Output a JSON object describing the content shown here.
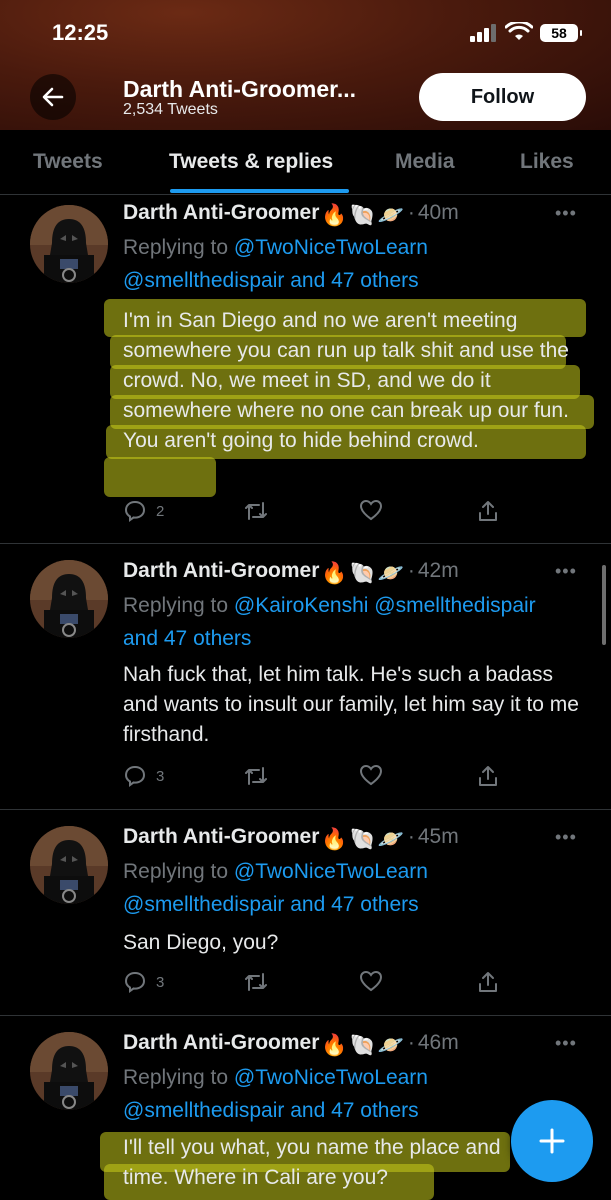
{
  "status": {
    "time": "12:25",
    "battery": "58"
  },
  "header": {
    "name": "Darth Anti-Groomer...",
    "tweet_count": "2,534 Tweets",
    "follow_label": "Follow"
  },
  "tabs": [
    {
      "label": "Tweets"
    },
    {
      "label": "Tweets & replies"
    },
    {
      "label": "Media"
    },
    {
      "label": "Likes"
    }
  ],
  "active_tab": "Tweets & replies",
  "tweets": [
    {
      "name": "Darth Anti-Groomer",
      "time": "40m",
      "reply_prefix": "Replying to ",
      "reply_line1_mentions": "@TwoNiceTwoLearn",
      "reply_line2_mentions": "@smellthedispair and 47 others",
      "text": "I'm in San Diego and no we aren't meeting somewhere you can run up talk shit and use the crowd. No, we meet in SD, and we do it somewhere where no one can break up our fun. You aren't going to hide behind crowd.",
      "reply_count": "2"
    },
    {
      "name": "Darth Anti-Groomer",
      "time": "42m",
      "reply_prefix": "Replying to ",
      "reply_line1_mentions": "@KairoKenshi @smellthedispair",
      "reply_line2_mentions": "and 47 others",
      "text": "Nah fuck that, let him talk. He's such a badass and wants to insult our family, let him say it to me firsthand.",
      "reply_count": "3"
    },
    {
      "name": "Darth Anti-Groomer",
      "time": "45m",
      "reply_prefix": "Replying to ",
      "reply_line1_mentions": "@TwoNiceTwoLearn",
      "reply_line2_mentions": "@smellthedispair and 47 others",
      "text": "San Diego, you?",
      "reply_count": "3"
    },
    {
      "name": "Darth Anti-Groomer",
      "time": "46m",
      "reply_prefix": "Replying to ",
      "reply_line1_mentions": "@TwoNiceTwoLearn",
      "reply_line2_mentions": "@smellthedispair and 47 others",
      "text": "I'll tell you what, you name the place and time. Where in Cali are you?",
      "reply_count": ""
    }
  ],
  "colors": {
    "accent": "#1d9bf0",
    "highlight": "#c8cc1c",
    "background": "#000000"
  }
}
